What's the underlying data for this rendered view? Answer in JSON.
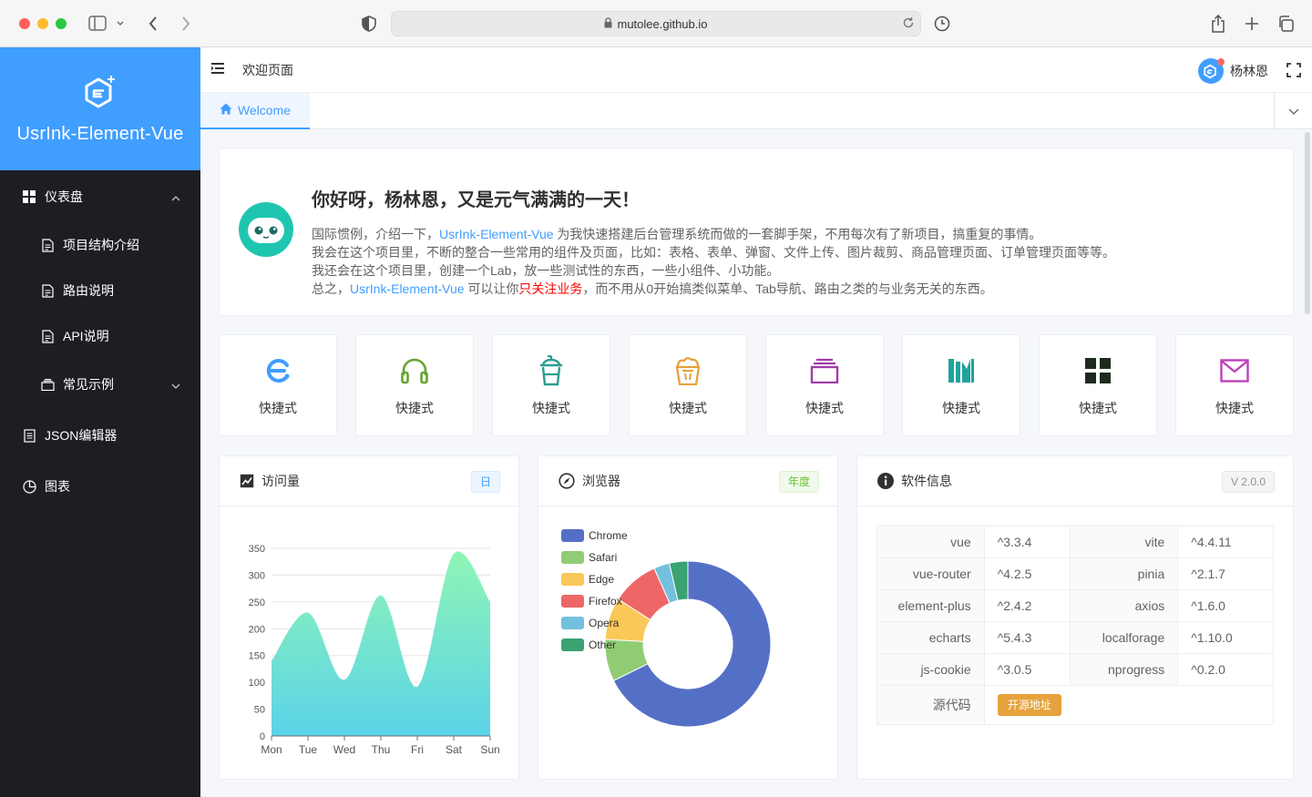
{
  "browser": {
    "url": "mutolee.github.io"
  },
  "sidebar": {
    "app_title": "UsrInk-Element-Vue",
    "items": [
      {
        "label": "仪表盘",
        "icon": "grid-icon",
        "expanded": true
      },
      {
        "label": "项目结构介绍",
        "icon": "document-icon"
      },
      {
        "label": "路由说明",
        "icon": "document-icon"
      },
      {
        "label": "API说明",
        "icon": "document-icon"
      },
      {
        "label": "常见示例",
        "icon": "stack-icon",
        "expanded": false
      },
      {
        "label": "JSON编辑器",
        "icon": "notebook-icon"
      },
      {
        "label": "图表",
        "icon": "pie-icon"
      }
    ]
  },
  "header": {
    "breadcrumb": "欢迎页面",
    "username": "杨林恩"
  },
  "tabs": [
    {
      "label": "Welcome",
      "active": true
    }
  ],
  "welcome": {
    "title": "你好呀，杨林恩，又是元气满满的一天！",
    "line1_prefix": "国际惯例，介绍一下，",
    "line1_link": "UsrInk-Element-Vue",
    "line1_suffix": " 为我快速搭建后台管理系统而做的一套脚手架，不用每次有了新项目，搞重复的事情。",
    "line2": "我会在这个项目里，不断的整合一些常用的组件及页面，比如：表格、表单、弹窗、文件上传、图片裁剪、商品管理页面、订单管理页面等等。",
    "line3": "我还会在这个项目里，创建一个Lab，放一些测试性的东西，一些小组件、小功能。",
    "line4_prefix": "总之，",
    "line4_link": "UsrInk-Element-Vue",
    "line4_mid": " 可以让你",
    "line4_highlight": "只关注业务",
    "line4_suffix": "，而不用从0开始搞类似菜单、Tab导航、路由之类的与业务无关的东西。"
  },
  "shortcuts": [
    {
      "label": "快捷式",
      "icon": "element-e-icon",
      "color": "#409eff"
    },
    {
      "label": "快捷式",
      "icon": "headset-icon",
      "color": "#67a332"
    },
    {
      "label": "快捷式",
      "icon": "cup-icon",
      "color": "#2a9d8f"
    },
    {
      "label": "快捷式",
      "icon": "popcorn-icon",
      "color": "#e6a23c"
    },
    {
      "label": "快捷式",
      "icon": "layers-icon",
      "color": "#a23ca8"
    },
    {
      "label": "快捷式",
      "icon": "books-icon",
      "color": "#1fa39b"
    },
    {
      "label": "快捷式",
      "icon": "grid-icon",
      "color": "#1d2b1d"
    },
    {
      "label": "快捷式",
      "icon": "mail-icon",
      "color": "#c040b8"
    }
  ],
  "visits": {
    "title": "访问量",
    "tag": "日"
  },
  "browsers": {
    "title": "浏览器",
    "tag": "年度"
  },
  "software": {
    "title": "软件信息",
    "tag": "V 2.0.0",
    "rows": [
      [
        {
          "k": "vue",
          "v": "^3.3.4"
        },
        {
          "k": "vite",
          "v": "^4.4.11"
        }
      ],
      [
        {
          "k": "vue-router",
          "v": "^4.2.5"
        },
        {
          "k": "pinia",
          "v": "^2.1.7"
        }
      ],
      [
        {
          "k": "element-plus",
          "v": "^2.4.2"
        },
        {
          "k": "axios",
          "v": "^1.6.0"
        }
      ],
      [
        {
          "k": "echarts",
          "v": "^5.4.3"
        },
        {
          "k": "localforage",
          "v": "^1.10.0"
        }
      ],
      [
        {
          "k": "js-cookie",
          "v": "^3.0.5"
        },
        {
          "k": "nprogress",
          "v": "^0.2.0"
        }
      ]
    ],
    "source_label": "源代码",
    "source_button": "开源地址"
  },
  "chart_data": [
    {
      "type": "area",
      "categories": [
        "Mon",
        "Tue",
        "Wed",
        "Thu",
        "Fri",
        "Sat",
        "Sun"
      ],
      "values": [
        140,
        230,
        105,
        262,
        92,
        340,
        250
      ],
      "ylim": [
        0,
        350
      ],
      "yticks": [
        0,
        50,
        100,
        150,
        200,
        250,
        300,
        350
      ],
      "smooth": true,
      "grid": true,
      "colors": [
        "#5bd3e8",
        "#8ff5b5"
      ]
    },
    {
      "type": "pie",
      "donut": true,
      "legend": "left",
      "slices": [
        {
          "name": "Chrome",
          "value": 66,
          "color": "#5470c6"
        },
        {
          "name": "Safari",
          "value": 8,
          "color": "#91cc75"
        },
        {
          "name": "Edge",
          "value": 8,
          "color": "#fac858"
        },
        {
          "name": "Firefox",
          "value": 9,
          "color": "#ee6666"
        },
        {
          "name": "Opera",
          "value": 3,
          "color": "#73c0de"
        },
        {
          "name": "Other",
          "value": 3.5,
          "color": "#3ba272"
        }
      ]
    }
  ]
}
